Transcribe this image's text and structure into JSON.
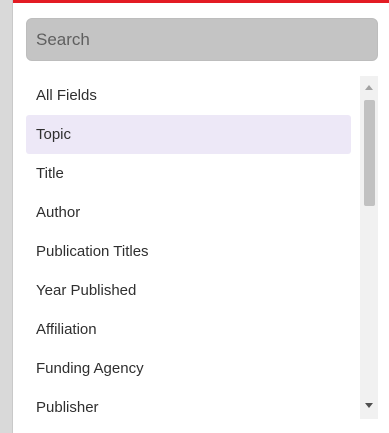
{
  "search": {
    "placeholder": "Search",
    "value": ""
  },
  "dropdown": {
    "items": [
      {
        "label": "All Fields"
      },
      {
        "label": "Topic"
      },
      {
        "label": "Title"
      },
      {
        "label": "Author"
      },
      {
        "label": "Publication Titles"
      },
      {
        "label": "Year Published"
      },
      {
        "label": "Affiliation"
      },
      {
        "label": "Funding Agency"
      },
      {
        "label": "Publisher"
      }
    ],
    "highlighted_item": "Topic"
  },
  "colors": {
    "accent": "#e31b23",
    "highlight": "#ede8f7",
    "search_bg": "#c4c4c4"
  }
}
